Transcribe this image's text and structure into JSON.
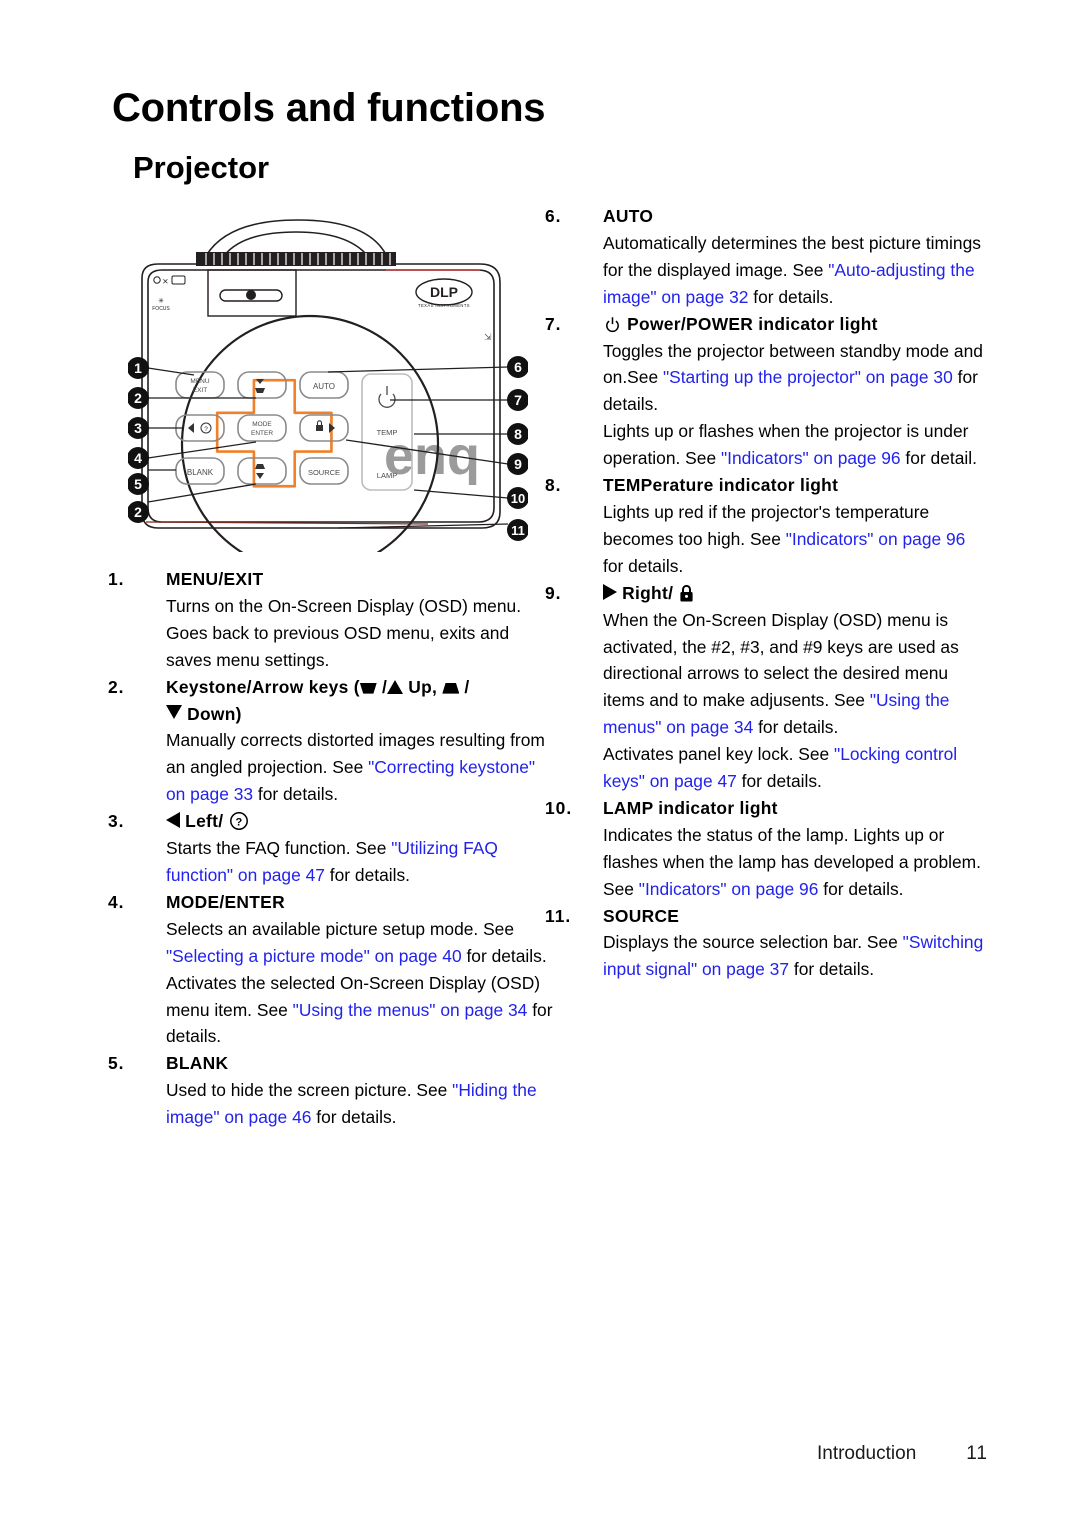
{
  "page": {
    "title": "Controls and functions",
    "section": "Projector",
    "footer_label": "Introduction",
    "footer_page": "11",
    "link_color": "#2222ee"
  },
  "figure": {
    "name": "projector-top-view-diagram",
    "brand_watermark": "benq",
    "dlp_logo": "DLP",
    "dlp_sub": "TEXAS INSTRUMENTS",
    "focus_label": "FOCUS",
    "keys": [
      {
        "id": "menu-exit",
        "line1": "MENU",
        "line2": "EXIT"
      },
      {
        "id": "keystone-up",
        "line1": "",
        "line2": ""
      },
      {
        "id": "auto",
        "line1": "AUTO",
        "line2": ""
      },
      {
        "id": "left-faq",
        "line1": "",
        "line2": ""
      },
      {
        "id": "mode-enter",
        "line1": "MODE",
        "line2": "ENTER"
      },
      {
        "id": "right-lock",
        "line1": "",
        "line2": ""
      },
      {
        "id": "blank",
        "line1": "BLANK",
        "line2": ""
      },
      {
        "id": "keystone-down",
        "line1": "",
        "line2": ""
      },
      {
        "id": "source",
        "line1": "SOURCE",
        "line2": ""
      }
    ],
    "indicators": [
      {
        "id": "power-indicator",
        "label": ""
      },
      {
        "id": "temp-indicator",
        "label": "TEMP"
      },
      {
        "id": "lamp-indicator",
        "label": "LAMP"
      }
    ],
    "callouts": [
      "1",
      "2",
      "3",
      "4",
      "5",
      "2",
      "6",
      "7",
      "8",
      "9",
      "10",
      "11"
    ]
  },
  "left_column": {
    "items": [
      {
        "num": "1.",
        "title": "MENU/EXIT",
        "paras": [
          "Turns on the On-Screen Display (OSD) menu. Goes back to previous OSD menu, exits and saves menu settings."
        ]
      },
      {
        "num": "2.",
        "title_prefix": "Keystone/Arrow keys (",
        "title_up": "Up,",
        "title_down": "Down)",
        "paras_pre": "Manually corrects distorted images resulting from an angled projection. See ",
        "link1": "\"Correcting keystone\" on page 33",
        "paras_post": " for details."
      },
      {
        "num": "3.",
        "title_text": "Left/",
        "paras_pre": "Starts the FAQ function. See ",
        "link1": "\"Utilizing FAQ function\" on page 47",
        "paras_post": " for details."
      },
      {
        "num": "4.",
        "title": "MODE/ENTER",
        "p1_pre": "Selects an available picture setup mode. See ",
        "p1_link": "\"Selecting a picture mode\" on page 40",
        "p1_post": " for details.",
        "p2_pre": "Activates the selected On-Screen Display (OSD) menu item. See ",
        "p2_link": "\"Using the menus\" on page 34",
        "p2_post": " for details."
      },
      {
        "num": "5.",
        "title": "BLANK",
        "paras_pre": "Used to hide the screen picture. See ",
        "link1": "\"Hiding the image\" on page 46",
        "paras_post": " for details."
      }
    ]
  },
  "right_column": {
    "items": [
      {
        "num": "6.",
        "title": "AUTO",
        "p1_pre": "Automatically determines the best picture timings for the displayed image. See ",
        "p1_link": "\"Auto-adjusting the image\" on page 32",
        "p1_post": " for details."
      },
      {
        "num": "7.",
        "title_text": "Power/POWER indicator light",
        "p1_pre": "Toggles the projector between standby mode and on.See ",
        "p1_link": "\"Starting up the projector\" on page 30",
        "p1_post": " for details.",
        "p2_pre": "Lights up or flashes when the projector is under operation. See ",
        "p2_link": "\"Indicators\" on page 96",
        "p2_post": " for detail."
      },
      {
        "num": "8.",
        "title": "TEMPerature indicator light",
        "p1_pre": "Lights up red if the projector's temperature becomes too high. See ",
        "p1_link": "\"Indicators\" on page 96",
        "p1_post": " for details."
      },
      {
        "num": "9.",
        "title_text": "Right/",
        "p1_pre": "When the On-Screen Display (OSD) menu is activated, the #2, #3, and #9 keys are used as directional arrows to select the desired menu items and to make adjusents. See ",
        "p1_link": "\"Using the menus\" on page 34",
        "p1_post": " for details.",
        "p2_pre": "Activates panel key lock. See ",
        "p2_link": "\"Locking control keys\" on page 47",
        "p2_post": " for details."
      },
      {
        "num": "10.",
        "title": "LAMP indicator light",
        "p1_pre": "Indicates the status of the lamp. Lights up or flashes when the lamp has developed a problem. See ",
        "p1_link": "\"Indicators\" on page 96",
        "p1_post": " for details."
      },
      {
        "num": "11.",
        "title": "SOURCE",
        "p1_pre": "Displays the source selection bar. See ",
        "p1_link": "\"Switching input signal\" on page 37",
        "p1_post": " for details."
      }
    ]
  }
}
